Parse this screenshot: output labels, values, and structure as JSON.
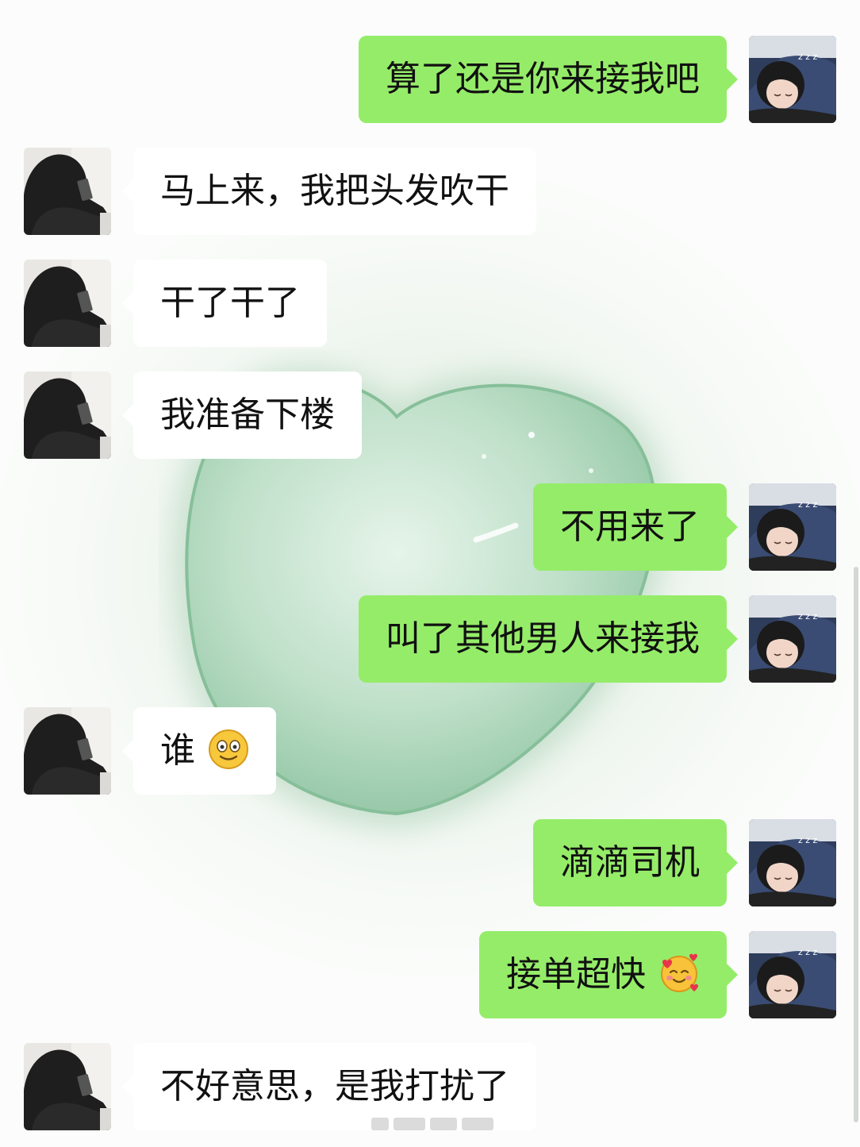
{
  "chat": {
    "messages": [
      {
        "side": "right",
        "text": "算了还是你来接我吧",
        "avatar": "sleeping-girl-avatar"
      },
      {
        "side": "left",
        "text": "马上来，我把头发吹干",
        "avatar": "hooded-boy-avatar"
      },
      {
        "side": "left",
        "text": "干了干了",
        "avatar": "hooded-boy-avatar"
      },
      {
        "side": "left",
        "text": "我准备下楼",
        "avatar": "hooded-boy-avatar"
      },
      {
        "side": "right",
        "text": "不用来了",
        "avatar": "sleeping-girl-avatar"
      },
      {
        "side": "right",
        "text": "叫了其他男人来接我",
        "avatar": "sleeping-girl-avatar"
      },
      {
        "side": "left",
        "text": "谁",
        "emoji": "smile-emoji",
        "avatar": "hooded-boy-avatar"
      },
      {
        "side": "right",
        "text": "滴滴司机",
        "avatar": "sleeping-girl-avatar"
      },
      {
        "side": "right",
        "text": "接单超快",
        "emoji": "smiling-hearts-emoji",
        "avatar": "sleeping-girl-avatar"
      },
      {
        "side": "left",
        "text": "不好意思，是我打扰了",
        "avatar": "hooded-boy-avatar"
      }
    ]
  },
  "colors": {
    "sent_bubble": "#95ec69",
    "received_bubble": "#ffffff",
    "background_heart": "#a8d3b8"
  }
}
